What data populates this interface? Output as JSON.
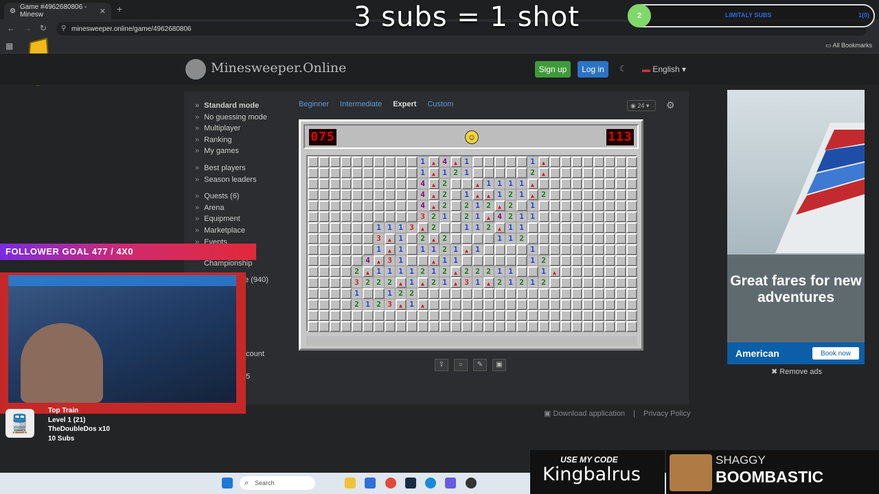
{
  "browser": {
    "tab_title": "Game #4962680806 - Minesw",
    "url": "minesweeper.online/game/4962680806",
    "all_bookmarks": "All Bookmarks"
  },
  "overlay": {
    "title": "3 subs = 1 shot",
    "goal_count": "2",
    "goal_label": "LIMITALY SUBS",
    "goal_right": "1(0)",
    "follower_goal": "FOLLOWER GOAL 477 / 4X0",
    "train_title": "Top Train",
    "train_level": "Level 1 (21)",
    "train_user": "TheDoubleDos x10",
    "train_subs": "10 Subs",
    "promo_small": "USE MY CODE",
    "promo_code": "Kingbalrus",
    "shaggy_top": "SHAGGY",
    "shaggy_bottom": "BOOMBASTIC"
  },
  "site": {
    "logo": "Minesweeper.Online",
    "signup": "Sign up",
    "login": "Log in",
    "language": "English",
    "menu": {
      "group1": [
        "Standard mode",
        "No guessing mode",
        "Multiplayer",
        "Ranking",
        "My games"
      ],
      "group2": [
        "Best players",
        "Season leaders"
      ],
      "group3": [
        "Quests (6)",
        "Arena",
        "Equipment",
        "Marketplace",
        "Events"
      ],
      "championship": "Championship",
      "partial1": "e (940)",
      "partial2": "count",
      "partial3": "5"
    },
    "levels": [
      "Beginner",
      "Intermediate",
      "Expert",
      "Custom"
    ],
    "active_level": "Expert",
    "zoom": "24",
    "mines_left": "075",
    "timer": "113",
    "footer_download": "Download application",
    "footer_privacy": "Privacy Policy"
  },
  "board": {
    "rows": 16,
    "cols": 30,
    "revealed": [
      "..........1F4F1.....1F........",
      "..........1F121.....2F........",
      "..........4F2..F1111F.........",
      "..........4F2.1FF121F2........",
      "..........4F2.212F2.1.........",
      "..........321.21F4211.........",
      "......1113F2..112F11..........",
      "......3F1.2F2....112..........",
      "......1F1.1121F1....1.........",
      ".....4F31..F11......12........",
      "....2F1111212F22211..1F.......",
      "....3222F1F21F31F21212........",
      "....1..122....................",
      "....2123F1F...................",
      "..............................",
      ".............................."
    ]
  },
  "ad": {
    "headline": "Great fares for new adventures",
    "brand": "American",
    "cta": "Book now",
    "remove": "Remove ads"
  },
  "taskbar": {
    "search": "Search"
  },
  "colors": {
    "1": "#1e3fd8",
    "2": "#117a11",
    "3": "#d81e1e",
    "4": "#800080",
    "5": "#7b0000",
    "6": "#008080"
  }
}
